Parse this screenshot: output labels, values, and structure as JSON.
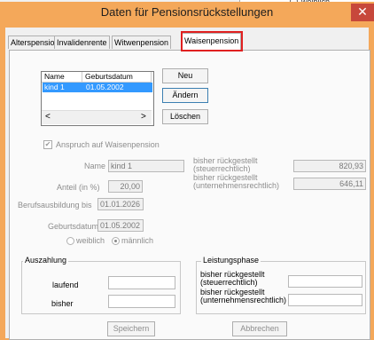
{
  "background": {
    "radio_label": "weiblich"
  },
  "window": {
    "title": "Daten für Pensionsrückstellungen",
    "close_glyph": "✕"
  },
  "tabs": [
    {
      "label": "Alterspension"
    },
    {
      "label": "Invalidenrente"
    },
    {
      "label": "Witwenpension"
    },
    {
      "label": "Waisenpension"
    }
  ],
  "list": {
    "col_name": "Name",
    "col_birth": "Geburtsdatum",
    "rows": [
      {
        "name": "kind 1",
        "birth": "01.05.2002"
      }
    ],
    "scroll_left": "<",
    "scroll_right": ">"
  },
  "buttons": {
    "new": "Neu",
    "edit": "Ändern",
    "delete": "Löschen",
    "save": "Speichern",
    "cancel": "Abbrechen"
  },
  "form": {
    "claim_label": "Anspruch auf Waisenpension",
    "claim_checked": true,
    "name_label": "Name",
    "name_value": "kind 1",
    "share_label": "Anteil (in %)",
    "share_value": "20,00",
    "education_label": "Berufsausbildung bis",
    "education_value": "01.01.2026",
    "birth_label": "Geburtsdatum",
    "birth_value": "01.05.2002",
    "gender_female": "weiblich",
    "gender_male": "männlich",
    "gender_selected": "männlich"
  },
  "reserves": {
    "tax_label_1": "bisher rückgestellt",
    "tax_label_2": "(steuerrechtlich)",
    "tax_value": "820,93",
    "corp_label_1": "bisher rückgestellt",
    "corp_label_2": "(unternehmensrechtlich)",
    "corp_value": "646,11"
  },
  "payout": {
    "title": "Auszahlung",
    "current_label": "laufend",
    "so_far_label": "bisher"
  },
  "benefit": {
    "title": "Leistungsphase",
    "tax_label_1": "bisher rückgestellt",
    "tax_label_2": "(steuerrechtlich)",
    "corp_label_1": "bisher rückgestellt",
    "corp_label_2": "(unternehmensrechtlich)"
  },
  "colors": {
    "titlebar": "#f4a85a",
    "close": "#c7483b",
    "selection": "#3399ff",
    "highlight": "#e02020"
  }
}
